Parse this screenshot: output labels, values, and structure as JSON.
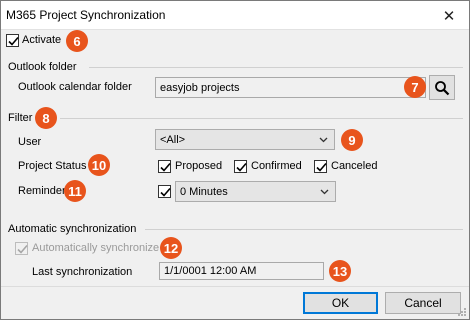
{
  "window": {
    "title": "M365 Project Synchronization"
  },
  "activate": {
    "label": "Activate",
    "checked": true,
    "badge": "6"
  },
  "outlook": {
    "section_title": "Outlook folder",
    "folder_label": "Outlook calendar folder",
    "folder_value": "easyjob projects",
    "badge": "7",
    "browse_icon": "search-icon"
  },
  "filter": {
    "section_title": "Filter",
    "badge": "8",
    "user_label": "User",
    "user_value": "<All>",
    "user_badge": "9",
    "status_label": "Project Status",
    "status_badge": "10",
    "statuses": [
      {
        "label": "Proposed",
        "checked": true
      },
      {
        "label": "Confirmed",
        "checked": true
      },
      {
        "label": "Canceled",
        "checked": true
      }
    ],
    "reminder_label": "Reminder",
    "reminder_badge": "11",
    "reminder_checked": true,
    "reminder_value": "0 Minutes"
  },
  "autosync": {
    "section_title": "Automatic synchronization",
    "auto_label": "Automatically synchronize",
    "auto_checked": true,
    "auto_disabled": true,
    "auto_badge": "12",
    "last_label": "Last synchronization",
    "last_value": "1/1/0001 12:00 AM",
    "last_badge": "13"
  },
  "buttons": {
    "ok": "OK",
    "cancel": "Cancel"
  },
  "colors": {
    "badge": "#e8541c",
    "accent": "#0078d7"
  }
}
